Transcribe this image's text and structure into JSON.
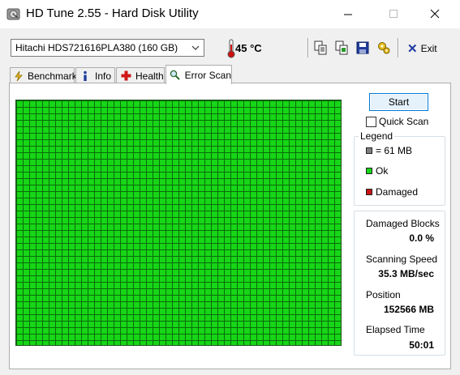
{
  "window": {
    "title": "HD Tune 2.55 - Hard Disk Utility"
  },
  "toolbar": {
    "drive": "Hitachi HDS721616PLA380 (160 GB)",
    "temperature": "45 °C",
    "exit_label": "Exit",
    "icons": [
      "copy-text-icon",
      "copy-image-icon",
      "save-icon",
      "options-icon",
      "exit-icon"
    ]
  },
  "tabs": [
    {
      "label": "Benchmark",
      "icon": "benchmark-icon",
      "active": false
    },
    {
      "label": "Info",
      "icon": "info-icon",
      "active": false
    },
    {
      "label": "Health",
      "icon": "health-icon",
      "active": false
    },
    {
      "label": "Error Scan",
      "icon": "magnifier-icon",
      "active": true
    }
  ],
  "scan": {
    "start_label": "Start",
    "quick_scan_label": "Quick Scan",
    "quick_scan_checked": false,
    "block_color_ok": "#17d617"
  },
  "legend": {
    "title": "Legend",
    "items": [
      {
        "label": "= 61 MB",
        "color": "#808080"
      },
      {
        "label": "Ok",
        "color": "#17d617"
      },
      {
        "label": "Damaged",
        "color": "#c81414"
      }
    ]
  },
  "stats": {
    "damaged_blocks_label": "Damaged Blocks",
    "damaged_blocks_value": "0.0 %",
    "scanning_speed_label": "Scanning Speed",
    "scanning_speed_value": "35.3 MB/sec",
    "position_label": "Position",
    "position_value": "152566 MB",
    "elapsed_time_label": "Elapsed Time",
    "elapsed_time_value": "50:01"
  }
}
